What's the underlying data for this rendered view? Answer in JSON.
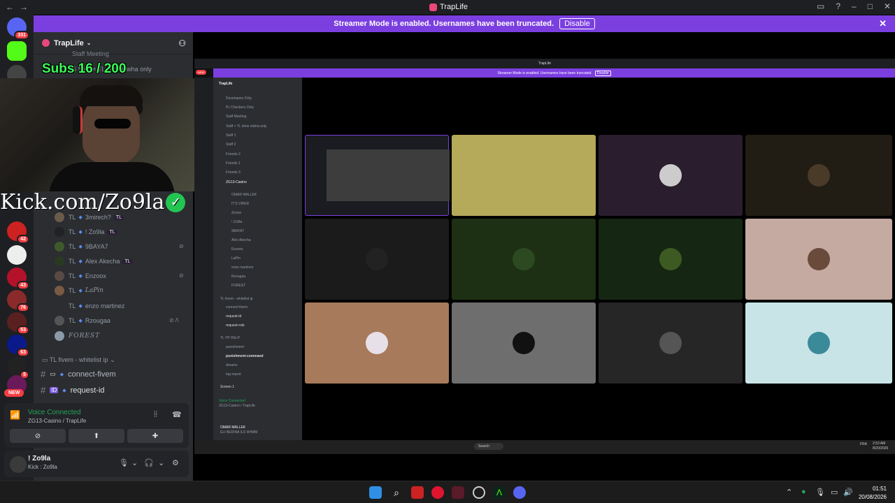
{
  "window": {
    "title": "TrapLife"
  },
  "streamer_banner": {
    "text": "Streamer Mode is enabled. Usernames have been truncated.",
    "disable_label": "Disable"
  },
  "servers": {
    "dm_badge": "331",
    "badges": [
      "42",
      "43",
      "76",
      "53",
      "63",
      "5"
    ],
    "new_label": "NEW"
  },
  "guild": {
    "name": "TrapLife",
    "faded_top": "Staff Meeting",
    "faded_second": "S   Staff + TL klme elwha only"
  },
  "overlay": {
    "subs": "Subs 16 / 200",
    "kick": "Kick.com/Zo9la"
  },
  "members": [
    {
      "prefix": "TL",
      "name": "3mirech?",
      "tag": "TL"
    },
    {
      "prefix": "TL",
      "name": "! Zo9la",
      "tag": "TL"
    },
    {
      "prefix": "TL",
      "name": "9BAYA7",
      "tag": ""
    },
    {
      "prefix": "TL",
      "name": "Alex Akecha",
      "tag": "TL"
    },
    {
      "prefix": "TL",
      "name": "Enzoox",
      "tag": ""
    },
    {
      "prefix": "TL",
      "name": "LaPin",
      "tag": ""
    },
    {
      "prefix": "TL",
      "name": "enzo martinez",
      "tag": ""
    },
    {
      "prefix": "TL",
      "name": "Rzougaa",
      "tag": ""
    },
    {
      "prefix": "",
      "name": "FOREST",
      "tag": ""
    }
  ],
  "category": {
    "label": "TL fivem - whitelist ip"
  },
  "channels": [
    {
      "name": "connect-fivem"
    },
    {
      "name": "request-id"
    }
  ],
  "voice": {
    "status": "Voice Connected",
    "location": "ZG13-Casino / TrapLife"
  },
  "user": {
    "name": "! Zo9la",
    "status": "Kick : Zo9la"
  },
  "screenshare": {
    "title": "TrapLife",
    "banner": "Streamer Mode is enabled. Usernames have been truncated.",
    "disable": "Disable",
    "new_label": "NEW",
    "guild": "TrapLife",
    "channels": [
      "Developers Only",
      "Pc Checkers Only",
      "Staff Meeting",
      "Staff + TL klme elwha only",
      "Staff 1",
      "Staff 2",
      "Friends 2",
      "Friends 1",
      "Friends 3",
      "ZG13-Casino",
      "OMAR MALLEK",
      "IT'S VIPER",
      "Zenno",
      "! Zo9la",
      "9BAYA7",
      "Alex Akecha",
      "Enzoox",
      "LaPin",
      "enzo martinez",
      "Rzougaa",
      "FOREST",
      "TL fivem - whitelist ip",
      "connect-fivem",
      "request-id",
      "request-role",
      "TL YP HELP",
      "punishment",
      "punishment-command",
      "dreams",
      "tag-report"
    ],
    "screen_label": "Screen 1",
    "voice_status": "Voice Connected",
    "voice_location": "ZG13-Casino / TrapLife",
    "user_name": "OMAR MALLEK",
    "user_status": "ELI BEDINA ILD RHMM",
    "search": "Search",
    "time": "2:53 AM",
    "date": "8/20/2026",
    "lang": "FRA"
  },
  "taskbar": {
    "time": "01:51",
    "date": "20/08/2026"
  },
  "colors": {
    "accent": "#7b3fe0",
    "online": "#23a55a",
    "badge": "#f23f43",
    "overlay_green": "#3cff5a"
  }
}
